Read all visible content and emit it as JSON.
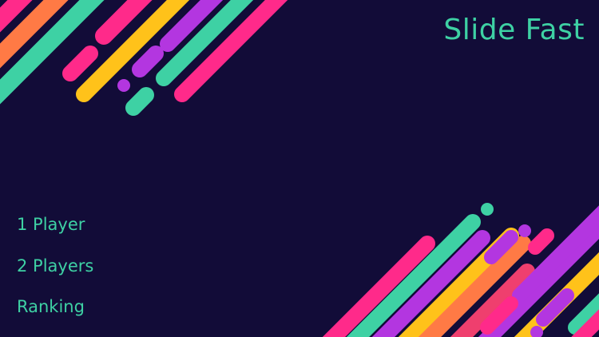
{
  "game": {
    "title": "Slide Fast"
  },
  "menu": {
    "items": [
      {
        "id": "1-player",
        "label": "1 Player"
      },
      {
        "id": "2-players",
        "label": "2 Players"
      },
      {
        "id": "ranking",
        "label": "Ranking"
      }
    ]
  },
  "theme": {
    "background": "#120c38",
    "text_color": "#3ed1a4",
    "stripe_colors": [
      "#ff2a8a",
      "#ff7a45",
      "#ffc21a",
      "#b336e0",
      "#3ed1a4",
      "#ef3f6e"
    ]
  }
}
